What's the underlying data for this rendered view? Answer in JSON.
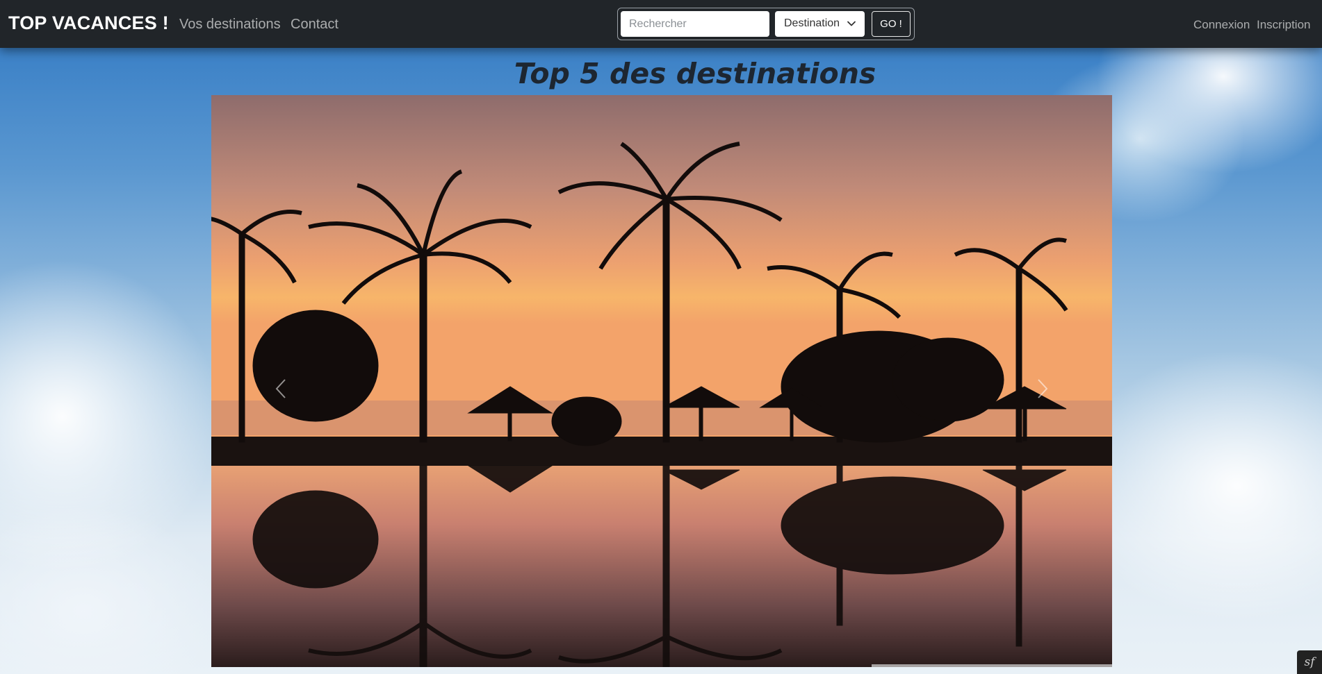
{
  "navbar": {
    "brand": "TOP VACANCES !",
    "links": [
      "Vos destinations",
      "Contact"
    ],
    "search": {
      "placeholder": "Rechercher",
      "value": ""
    },
    "select": {
      "selected": "Destination"
    },
    "go_label": "GO !",
    "right_links": [
      "Connexion",
      "Inscription"
    ]
  },
  "main": {
    "title": "Top 5 des destinations"
  },
  "carousel": {
    "slide_description": "tropical-sunset-palm-trees-pool-reflection",
    "prev_icon": "chevron-left-icon",
    "next_icon": "chevron-right-icon"
  },
  "debug_toolbar": {
    "icon": "symfony-icon"
  },
  "colors": {
    "navbar_bg": "#212529",
    "title_color": "#1d2631"
  }
}
